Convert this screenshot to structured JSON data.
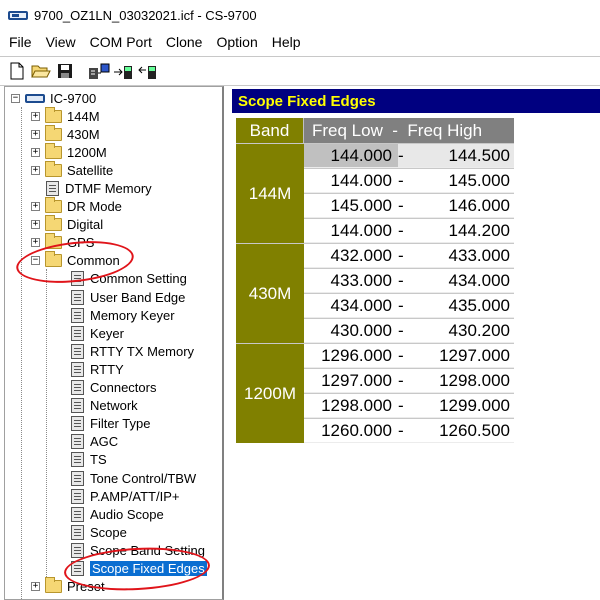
{
  "window": {
    "title": "9700_OZ1LN_03032021.icf - CS-9700"
  },
  "menu": [
    "File",
    "View",
    "COM Port",
    "Clone",
    "Option",
    "Help"
  ],
  "toolbar": {
    "buttons": [
      "new-icon",
      "open-icon",
      "save-icon",
      "read-radio-icon",
      "write-radio-icon",
      "clone-radio-icon"
    ]
  },
  "tree": {
    "root": "IC-9700",
    "items": [
      {
        "label": "144M",
        "type": "folder",
        "expander": "+"
      },
      {
        "label": "430M",
        "type": "folder",
        "expander": "+"
      },
      {
        "label": "1200M",
        "type": "folder",
        "expander": "+"
      },
      {
        "label": "Satellite",
        "type": "folder",
        "expander": "+"
      },
      {
        "label": "DTMF Memory",
        "type": "doc"
      },
      {
        "label": "DR Mode",
        "type": "folder",
        "expander": "+"
      },
      {
        "label": "Digital",
        "type": "folder",
        "expander": "+"
      },
      {
        "label": "GPS",
        "type": "folder",
        "expander": "+"
      },
      {
        "label": "Common",
        "type": "folder",
        "expander": "-"
      },
      {
        "label": "Common Setting",
        "type": "doc"
      },
      {
        "label": "User Band Edge",
        "type": "doc"
      },
      {
        "label": "Memory Keyer",
        "type": "doc"
      },
      {
        "label": "Keyer",
        "type": "doc"
      },
      {
        "label": "RTTY TX Memory",
        "type": "doc"
      },
      {
        "label": "RTTY",
        "type": "doc"
      },
      {
        "label": "Connectors",
        "type": "doc"
      },
      {
        "label": "Network",
        "type": "doc"
      },
      {
        "label": "Filter Type",
        "type": "doc"
      },
      {
        "label": "AGC",
        "type": "doc"
      },
      {
        "label": "TS",
        "type": "doc"
      },
      {
        "label": "Tone Control/TBW",
        "type": "doc"
      },
      {
        "label": "P.AMP/ATT/IP+",
        "type": "doc"
      },
      {
        "label": "Audio Scope",
        "type": "doc"
      },
      {
        "label": "Scope",
        "type": "doc"
      },
      {
        "label": "Scope Band Setting",
        "type": "doc"
      },
      {
        "label": "Scope Fixed Edges",
        "type": "doc",
        "selected": true
      },
      {
        "label": "Preset",
        "type": "folder",
        "expander": "+"
      }
    ]
  },
  "panel": {
    "title": "Scope Fixed Edges",
    "header_band": "Band",
    "header_freq": "Freq Low  -  Freq High",
    "separator": "-",
    "bands": [
      {
        "band": "144M",
        "rows": [
          {
            "low": "144.000",
            "high": "144.500"
          },
          {
            "low": "144.000",
            "high": "145.000"
          },
          {
            "low": "145.000",
            "high": "146.000"
          },
          {
            "low": "144.000",
            "high": "144.200"
          }
        ]
      },
      {
        "band": "430M",
        "rows": [
          {
            "low": "432.000",
            "high": "433.000"
          },
          {
            "low": "433.000",
            "high": "434.000"
          },
          {
            "low": "434.000",
            "high": "435.000"
          },
          {
            "low": "430.000",
            "high": "430.200"
          }
        ]
      },
      {
        "band": "1200M",
        "rows": [
          {
            "low": "1296.000",
            "high": "1297.000"
          },
          {
            "low": "1297.000",
            "high": "1298.000"
          },
          {
            "low": "1298.000",
            "high": "1299.000"
          },
          {
            "low": "1260.000",
            "high": "1260.500"
          }
        ]
      }
    ]
  },
  "colors": {
    "panel_header_bg": "#000080",
    "panel_header_text": "#ffff00",
    "band_bg": "#808000",
    "freq_header_bg": "#808080",
    "selection": "#0a6ed1",
    "annotation": "#e0141a"
  }
}
